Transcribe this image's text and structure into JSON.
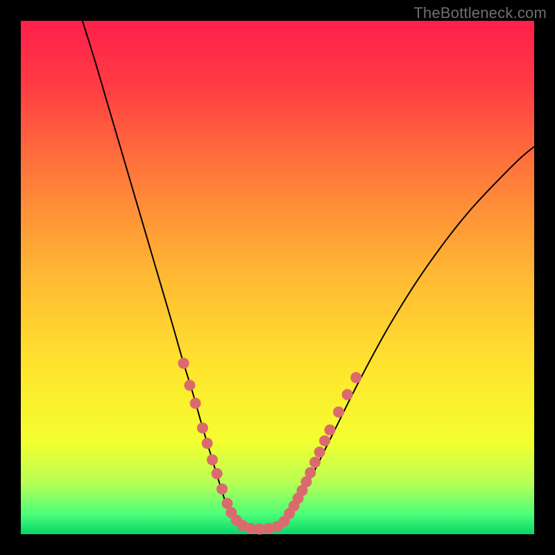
{
  "watermark": "TheBottleneck.com",
  "background": {
    "frame_color": "#000000",
    "gradient_stops": [
      {
        "offset": 0.0,
        "color": "#ff1f4a"
      },
      {
        "offset": 0.12,
        "color": "#ff3a44"
      },
      {
        "offset": 0.3,
        "color": "#ff7a3a"
      },
      {
        "offset": 0.5,
        "color": "#ffba33"
      },
      {
        "offset": 0.68,
        "color": "#ffe52e"
      },
      {
        "offset": 0.82,
        "color": "#f3ff2f"
      },
      {
        "offset": 0.9,
        "color": "#b8ff55"
      },
      {
        "offset": 0.96,
        "color": "#4eff78"
      },
      {
        "offset": 1.0,
        "color": "#05d76a"
      }
    ]
  },
  "chart_data": {
    "type": "line",
    "title": "",
    "xlabel": "",
    "ylabel": "",
    "xlim": [
      0,
      1
    ],
    "ylim": [
      0,
      1
    ],
    "note": "Axes are implicit (no ticks/labels). x,y normalized to the gradient plot area: x→right, y→down (y=0 at top).",
    "series": [
      {
        "name": "left-branch",
        "stroke": "#000000",
        "stroke_width": 2,
        "x": [
          0.12,
          0.145,
          0.17,
          0.195,
          0.22,
          0.245,
          0.27,
          0.295,
          0.315,
          0.335,
          0.352,
          0.367,
          0.38,
          0.39,
          0.398,
          0.407,
          0.417,
          0.43
        ],
        "y": [
          0.0,
          0.08,
          0.165,
          0.25,
          0.335,
          0.42,
          0.505,
          0.59,
          0.66,
          0.725,
          0.785,
          0.835,
          0.878,
          0.91,
          0.935,
          0.955,
          0.97,
          0.983
        ]
      },
      {
        "name": "valley-floor",
        "stroke": "#000000",
        "stroke_width": 2,
        "x": [
          0.43,
          0.445,
          0.46,
          0.475,
          0.49,
          0.505
        ],
        "y": [
          0.983,
          0.988,
          0.99,
          0.99,
          0.988,
          0.983
        ]
      },
      {
        "name": "right-branch",
        "stroke": "#000000",
        "stroke_width": 2,
        "x": [
          0.505,
          0.52,
          0.54,
          0.57,
          0.61,
          0.66,
          0.72,
          0.79,
          0.87,
          0.96,
          1.0
        ],
        "y": [
          0.983,
          0.965,
          0.935,
          0.88,
          0.8,
          0.7,
          0.59,
          0.48,
          0.375,
          0.28,
          0.245
        ]
      }
    ],
    "markers": {
      "name": "highlight-dots",
      "color": "#db6a6e",
      "radius_px": 8,
      "points": [
        {
          "x": 0.317,
          "y": 0.667
        },
        {
          "x": 0.329,
          "y": 0.71
        },
        {
          "x": 0.34,
          "y": 0.745
        },
        {
          "x": 0.354,
          "y": 0.793
        },
        {
          "x": 0.363,
          "y": 0.823
        },
        {
          "x": 0.373,
          "y": 0.855
        },
        {
          "x": 0.382,
          "y": 0.882
        },
        {
          "x": 0.392,
          "y": 0.912
        },
        {
          "x": 0.402,
          "y": 0.94
        },
        {
          "x": 0.41,
          "y": 0.958
        },
        {
          "x": 0.42,
          "y": 0.973
        },
        {
          "x": 0.432,
          "y": 0.983
        },
        {
          "x": 0.448,
          "y": 0.989
        },
        {
          "x": 0.465,
          "y": 0.99
        },
        {
          "x": 0.483,
          "y": 0.989
        },
        {
          "x": 0.5,
          "y": 0.985
        },
        {
          "x": 0.513,
          "y": 0.975
        },
        {
          "x": 0.523,
          "y": 0.96
        },
        {
          "x": 0.532,
          "y": 0.945
        },
        {
          "x": 0.54,
          "y": 0.93
        },
        {
          "x": 0.548,
          "y": 0.915
        },
        {
          "x": 0.556,
          "y": 0.898
        },
        {
          "x": 0.564,
          "y": 0.88
        },
        {
          "x": 0.573,
          "y": 0.86
        },
        {
          "x": 0.582,
          "y": 0.84
        },
        {
          "x": 0.592,
          "y": 0.818
        },
        {
          "x": 0.602,
          "y": 0.797
        },
        {
          "x": 0.619,
          "y": 0.762
        },
        {
          "x": 0.636,
          "y": 0.728
        },
        {
          "x": 0.653,
          "y": 0.695
        }
      ]
    }
  }
}
